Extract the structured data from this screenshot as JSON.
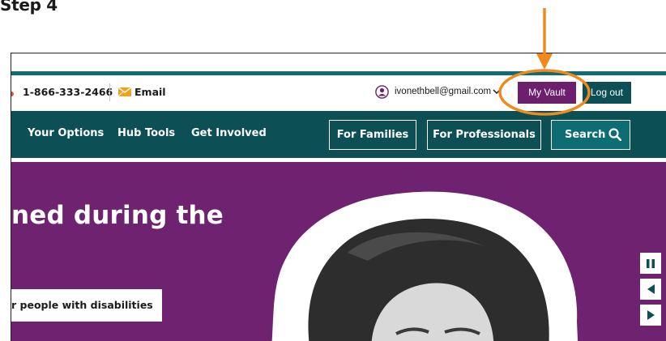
{
  "step": {
    "title": "Step 4"
  },
  "utility_bar": {
    "phone": "1-866-333-2466",
    "email_label": "Email",
    "user_email": "ivonethbell@gmail.com",
    "my_vault_label": "My Vault",
    "logout_label": "Log out"
  },
  "main_nav": {
    "items": [
      {
        "label": "Your Options"
      },
      {
        "label": "Hub Tools"
      },
      {
        "label": "Get Involved"
      }
    ],
    "for_families": "For Families",
    "for_professionals": "For Professionals",
    "search_label": "Search"
  },
  "hero": {
    "heading": "ned during the",
    "cta_label": "r people with disabilities",
    "background_color": "#6e2270"
  },
  "icons": {
    "email": "envelope-icon",
    "account": "user-avatar-icon",
    "search": "magnifier-icon",
    "pause": "pause-icon",
    "prev": "previous-arrow-icon",
    "next": "next-arrow-icon"
  },
  "colors": {
    "teal_dark": "#0c4f55",
    "teal": "#0e6d73",
    "purple": "#6d1f6e",
    "annotation_orange": "#f08a1d"
  }
}
